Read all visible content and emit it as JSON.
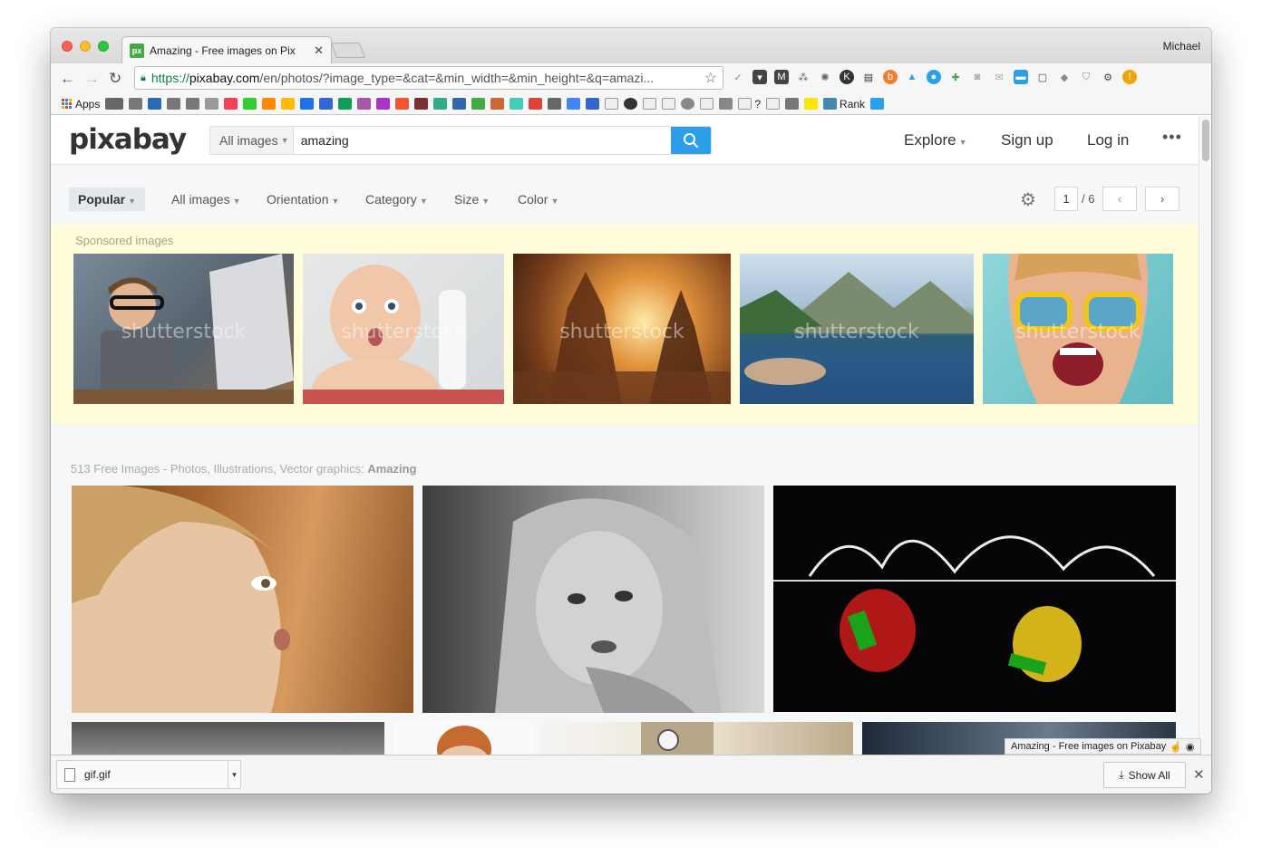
{
  "browser": {
    "tab_title": "Amazing - Free images on Pix",
    "tab_favicon": "px",
    "profile_name": "Michael",
    "url_scheme": "https://",
    "url_host": "pixabay.com",
    "url_path": "/en/photos/?image_type=&cat=&min_width=&min_height=&q=amazi..."
  },
  "bookmarks": {
    "apps_label": "Apps",
    "rank_label": "Rank",
    "question_label": "?"
  },
  "site": {
    "logo": "pixabay",
    "search_type": "All images",
    "search_query": "amazing",
    "nav": {
      "explore": "Explore",
      "signup": "Sign up",
      "login": "Log in",
      "more": "•••"
    }
  },
  "filters": {
    "popular": "Popular",
    "all_images": "All images",
    "orientation": "Orientation",
    "category": "Category",
    "size": "Size",
    "color": "Color",
    "page_current": "1",
    "page_total": "/ 6"
  },
  "sponsored": {
    "label": "Sponsored images",
    "watermark": "shutterstock",
    "images": [
      "boy-laptop",
      "surprised-baby",
      "temple-sunset",
      "mountain-lake",
      "woman-sunglasses"
    ]
  },
  "results": {
    "label_prefix": "513 Free Images - Photos, Illustrations, Vector graphics: ",
    "label_query": "Amazing"
  },
  "tooltip": "Amazing - Free images on Pixabay",
  "download": {
    "file_name": "gif.gif",
    "show_all": "Show All"
  },
  "colors": {
    "accent": "#2d9eea",
    "sponsored_bg": "#fffcd9",
    "favicon": "#48a947"
  }
}
